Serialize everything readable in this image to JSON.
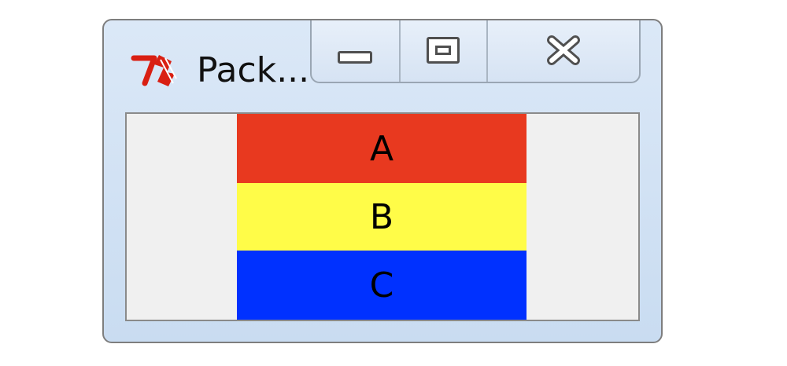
{
  "window": {
    "title": "Pack...",
    "app_icon": "tk-feather-icon",
    "buttons": {
      "minimize_icon": "minimize-icon",
      "maximize_icon": "maximize-icon",
      "close_icon": "close-icon"
    }
  },
  "content": {
    "labels": [
      {
        "text": "A",
        "color": "#e8391f"
      },
      {
        "text": "B",
        "color": "#fffc48"
      },
      {
        "text": "C",
        "color": "#0031ff"
      }
    ]
  },
  "colors": {
    "window_frame": "#dbe8f7",
    "client_background": "#f0f0f0",
    "text": "#000000"
  }
}
